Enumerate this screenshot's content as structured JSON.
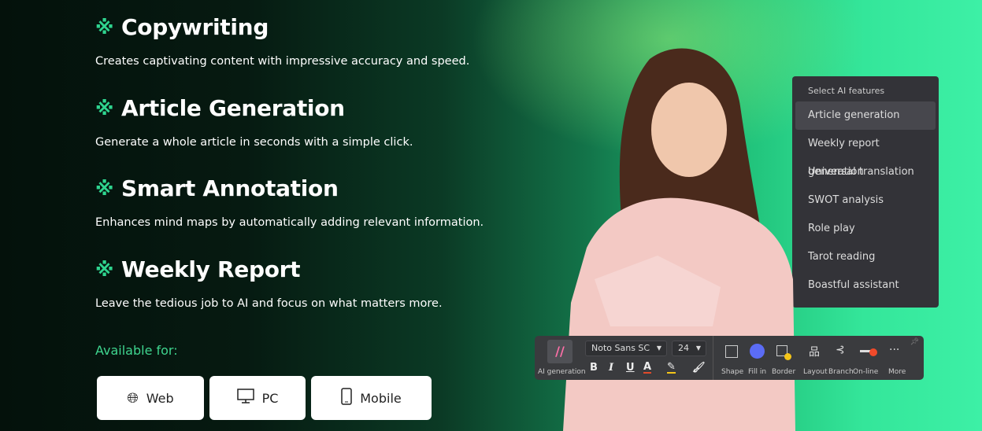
{
  "features": [
    {
      "title": "Copywriting",
      "desc": "Creates captivating content with impressive accuracy and speed.",
      "icon": "sparkle-icon"
    },
    {
      "title": "Article Generation",
      "desc": "Generate a whole article in seconds with a simple click.",
      "icon": "sparkle-icon"
    },
    {
      "title": "Smart Annotation",
      "desc": "Enhances mind maps by automatically adding relevant information.",
      "icon": "sparkle-icon"
    },
    {
      "title": "Weekly Report",
      "desc": "Leave the tedious job to AI and focus on what matters more.",
      "icon": "sparkle-icon"
    }
  ],
  "available": {
    "label": "Available for:",
    "platforms": [
      {
        "label": "Web",
        "icon": "globe-icon"
      },
      {
        "label": "PC",
        "icon": "monitor-icon"
      },
      {
        "label": "Mobile",
        "icon": "phone-icon"
      }
    ]
  },
  "ai_menu": {
    "header": "Select AI features",
    "items": [
      "Article generation",
      "Weekly report generation",
      "Universal translation",
      "SWOT analysis",
      "Role play",
      "Tarot reading",
      "Boastful assistant"
    ],
    "selected": "Article generation"
  },
  "toolbar": {
    "ai_label": "AI generation",
    "font": "Noto Sans SC",
    "size": "24",
    "bold": "B",
    "italic": "I",
    "underline": "U",
    "font_color": "A",
    "shape": "Shape",
    "fill": "Fill in",
    "border": "Border",
    "layout": "Layout",
    "branch": "Branch",
    "online": "On-line",
    "more": "More",
    "more_glyph": "···"
  },
  "colors": {
    "accent": "#2fd48f",
    "fill_color": "#5b6cf5",
    "border_dot": "#f5c518",
    "online_dot": "#f04a2a"
  }
}
